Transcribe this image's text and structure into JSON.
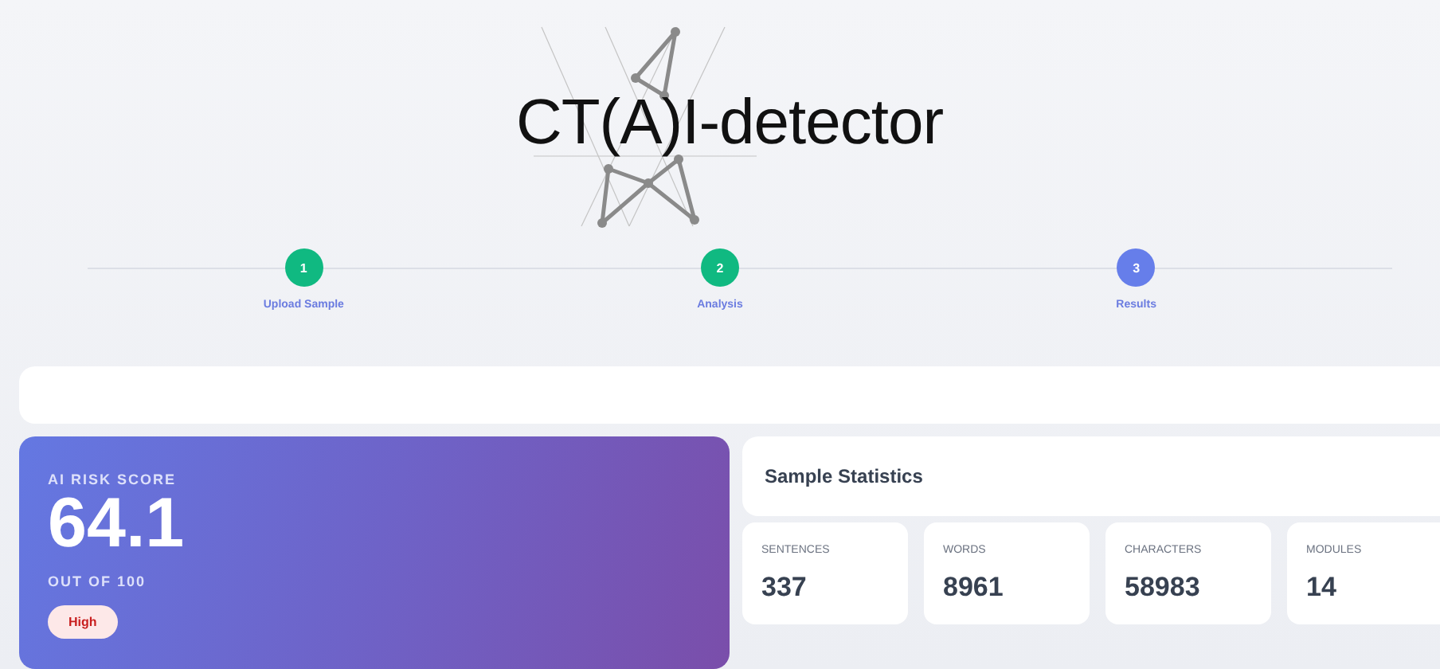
{
  "logo": {
    "title": "CT(A)I-detector"
  },
  "steps": [
    {
      "number": "1",
      "label": "Upload Sample",
      "selected": false
    },
    {
      "number": "2",
      "label": "Analysis",
      "selected": false
    },
    {
      "number": "3",
      "label": "Results",
      "selected": true
    }
  ],
  "risk": {
    "label": "AI RISK SCORE",
    "score": "64.1",
    "scale": "OUT OF 100",
    "badge": "High"
  },
  "statistics": {
    "title": "Sample Statistics",
    "items": [
      {
        "label": "SENTENCES",
        "value": "337"
      },
      {
        "label": "WORDS",
        "value": "8961"
      },
      {
        "label": "CHARACTERS",
        "value": "58983"
      },
      {
        "label": "MODULES",
        "value": "14"
      }
    ]
  }
}
